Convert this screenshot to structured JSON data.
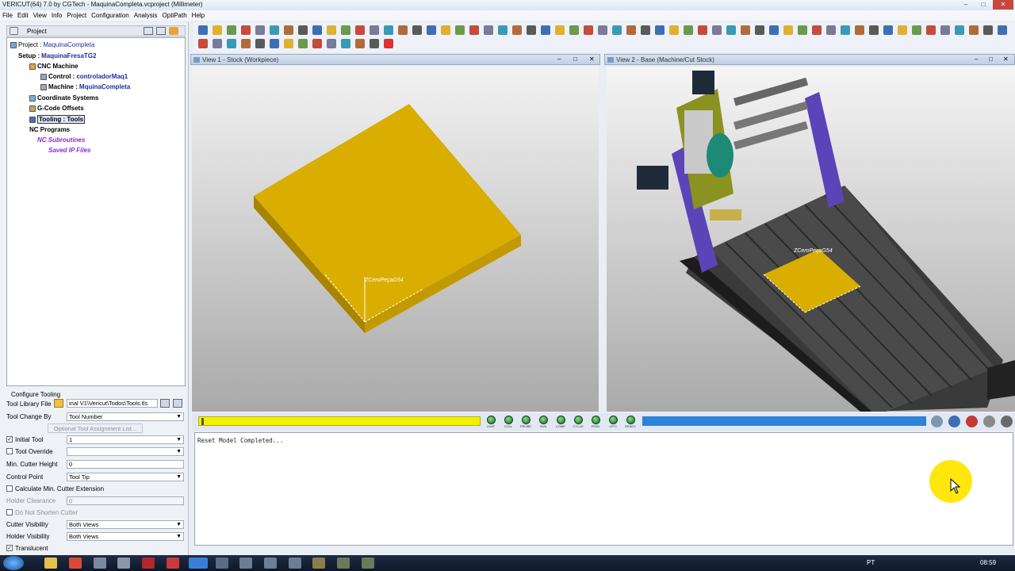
{
  "window": {
    "title": "VERICUT(64)  7.0 by CGTech - MaquinaCompleta.vcproject (Millimeter)"
  },
  "menu": [
    "File",
    "Edit",
    "View",
    "Info",
    "Project",
    "Configuration",
    "Analysis",
    "OptiPath",
    "Help"
  ],
  "project_panel": {
    "title": "Project",
    "tree": {
      "project_label": "Project : ",
      "project_name": "MaquinaCompleta",
      "setup_label": "Setup : ",
      "setup_name": "MaquinaFresaTG2",
      "cnc_machine": "CNC Machine",
      "control_label": "Control : ",
      "control_name": "controladorMaq1",
      "machine_label": "Machine : ",
      "machine_name": "MquinaCompleta",
      "coordinate_systems": "Coordinate Systems",
      "gcode_offsets": "G-Code Offsets",
      "tooling": "Tooling : Tools",
      "nc_programs": "NC Programs",
      "nc_subroutines": "NC Subroutines",
      "saved_ip_files": "Saved IP Files"
    }
  },
  "configure_tooling": {
    "header": "Configure Tooling",
    "tool_library_file_label": "Tool Library File",
    "tool_library_file_value": "inal V1\\Vericut\\Todos\\Tools.tls",
    "tool_change_by_label": "Tool Change By",
    "tool_change_by_value": "Tool Number",
    "optional_button": "Optional Tool Assignment List...",
    "initial_tool_label": "Initial Tool",
    "initial_tool_value": "1",
    "tool_override_label": "Tool Override",
    "min_cutter_height_label": "Min. Cutter Height",
    "min_cutter_height_value": "0",
    "control_point_label": "Control Point",
    "control_point_value": "Tool Tip",
    "calc_min_cutter_label": "Calculate Min. Cutter Extension",
    "holder_clearance_label": "Holder Clearance",
    "holder_clearance_value": "0",
    "do_not_shorten_label": "Do Not Shorten Cutter",
    "cutter_visibility_label": "Cutter Visibility",
    "cutter_visibility_value": "Both Views",
    "holder_visibility_label": "Holder Visibility",
    "holder_visibility_value": "Both Views",
    "translucent_label": "Translucent"
  },
  "views": {
    "view1_title": "View 1 - Stock (Workpiece)",
    "view2_title": "View 2 - Base (Machine/Cut Stock)",
    "view1_csys_label": "ZCeroPeçaG54",
    "view2_csys_label": "ZCeroPeçaG54",
    "stock_color": "#d4a800"
  },
  "indicators": [
    "LIMIT",
    "COLL",
    "PROBE",
    "SUB",
    "COMP",
    "CYCLE",
    "FEED",
    "OPTI",
    "READY"
  ],
  "console": {
    "text": "Reset Model Completed..."
  },
  "taskbar": {
    "language": "PT",
    "time": "08:59"
  },
  "colors": {
    "progress_yellow": "#f2f200",
    "progress_blue": "#2d83d8",
    "led_green": "#2f9a3a"
  }
}
